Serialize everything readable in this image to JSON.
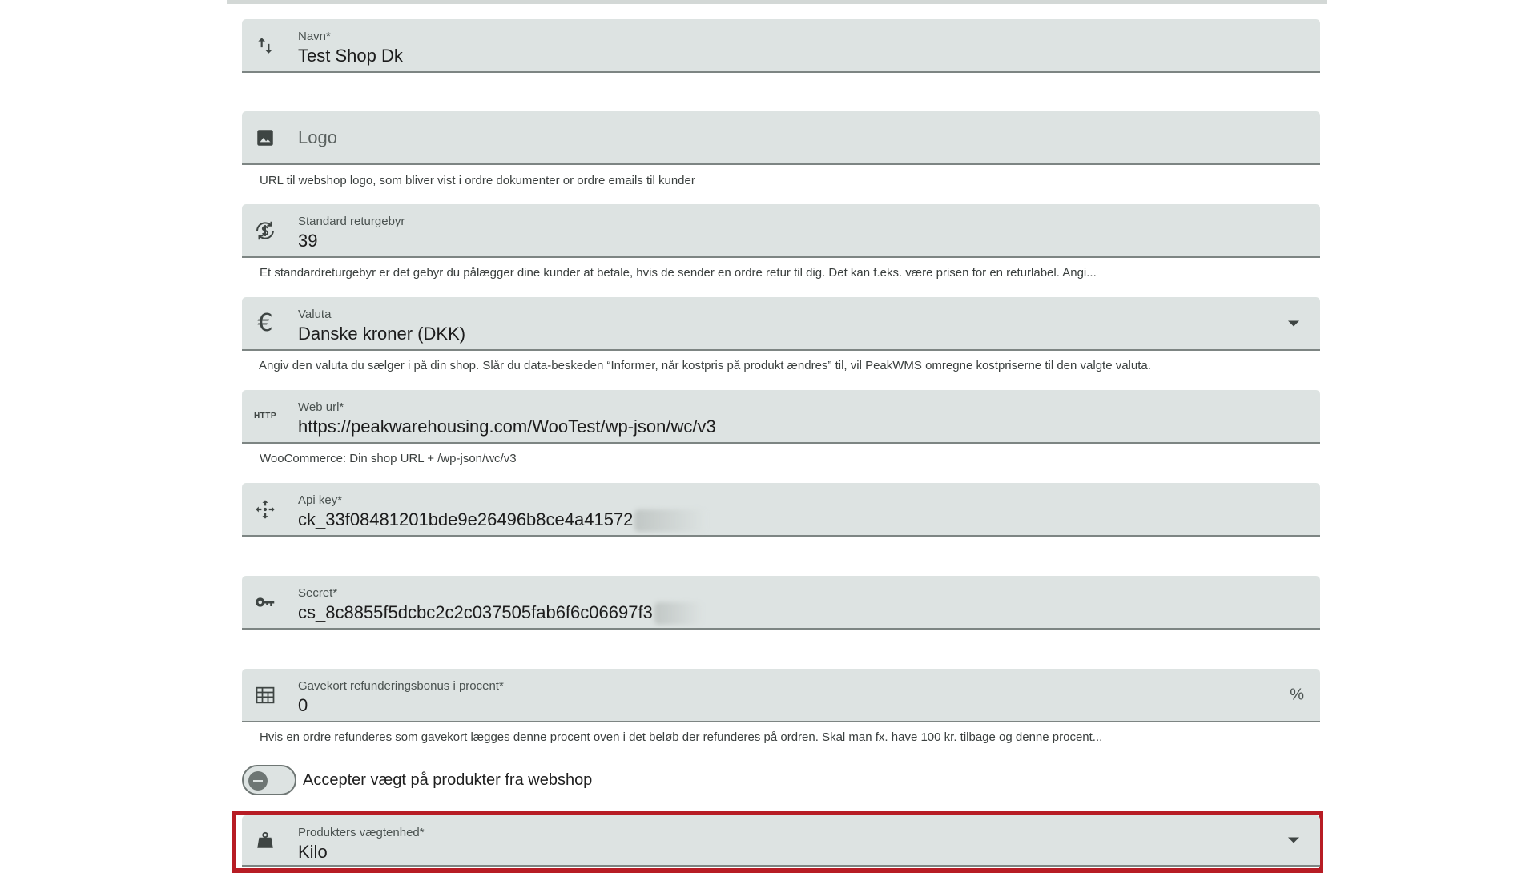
{
  "fields": {
    "name": {
      "label": "Navn*",
      "value": "Test Shop Dk",
      "icon": "swap-vertical-icon"
    },
    "logo": {
      "placeholder": "Logo",
      "hint": "URL til webshop logo, som bliver vist i ordre dokumenter or ordre emails til kunder",
      "icon": "image-icon"
    },
    "return_fee": {
      "label": "Standard returgebyr",
      "value": "39",
      "hint": "Et standardreturgebyr er det gebyr du pålægger dine kunder at betale, hvis de sender en ordre retur til dig. Det kan f.eks. være prisen for en returlabel. Angi...",
      "icon": "currency-exchange-icon"
    },
    "currency": {
      "label": "Valuta",
      "value": "Danske kroner (DKK)",
      "hint": "Angiv den valuta du sælger i på din shop. Slår du data-beskeden “Informer, når kostpris på produkt ændres” til, vil PeakWMS omregne kostpriserne til den valgte valuta.",
      "icon": "euro-icon"
    },
    "web_url": {
      "label": "Web url*",
      "value": "https://peakwarehousing.com/WooTest/wp-json/wc/v3",
      "hint": "WooCommerce: Din shop URL + /wp-json/wc/v3",
      "icon_text": "HTTP",
      "icon": "http-icon"
    },
    "api_key": {
      "label": "Api key*",
      "value": "ck_33f08481201bde9e26496b8ce4a41572",
      "icon": "move-icon"
    },
    "secret": {
      "label": "Secret*",
      "value": "cs_8c8855f5dcbc2c2c037505fab6f6c06697f3",
      "icon": "key-icon"
    },
    "giftcard_bonus": {
      "label": "Gavekort refunderingsbonus i procent*",
      "value": "0",
      "suffix": "%",
      "hint": "Hvis en ordre refunderes som gavekort lægges denne procent oven i det beløb der refunderes på ordren. Skal man fx. have 100 kr. tilbage og denne procent...",
      "icon": "table-icon"
    },
    "weight_unit": {
      "label": "Produkters vægtenhed*",
      "value": "Kilo",
      "icon": "weight-icon"
    }
  },
  "toggle": {
    "label": "Accepter vægt på produkter fra webshop",
    "checked": false
  },
  "colors": {
    "field_bg": "#dde3e2",
    "highlight": "#b71c24"
  }
}
